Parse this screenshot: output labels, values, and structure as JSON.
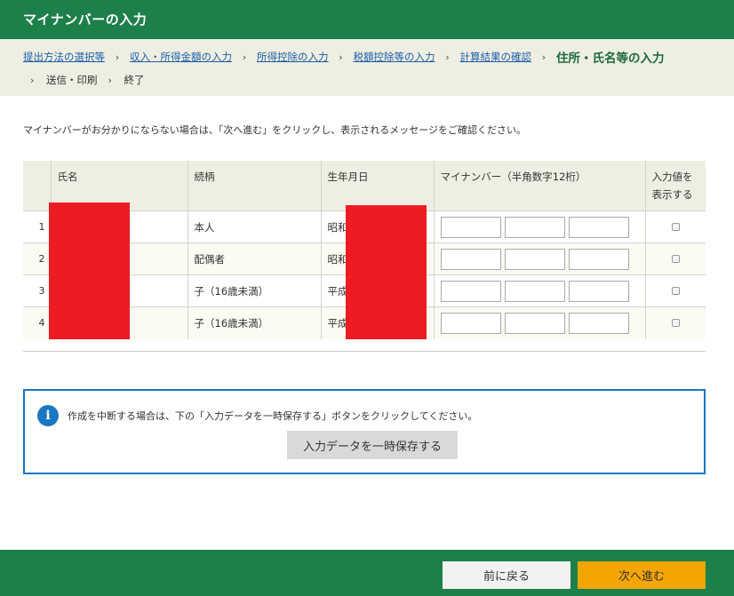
{
  "header": {
    "title": "マイナンバーの入力"
  },
  "breadcrumb": {
    "links": [
      "提出方法の選択等",
      "収入・所得金額の入力",
      "所得控除の入力",
      "税額控除等の入力",
      "計算結果の確認"
    ],
    "current": "住所・氏名等の入力",
    "remaining": [
      "送信・印刷",
      "終了"
    ],
    "separator": "›"
  },
  "instruction": "マイナンバーがお分かりにならない場合は、「次へ進む」をクリックし、表示されるメッセージをご確認ください。",
  "table": {
    "headers": {
      "no": "",
      "name": "氏名",
      "relation": "続柄",
      "birthdate": "生年月日",
      "mynumber": "マイナンバー（半角数字12桁）",
      "show_value_line1": "入力値を",
      "show_value_line2": "表示する"
    },
    "rows": [
      {
        "no": "1",
        "name": "",
        "relation": "本人",
        "birthdate": "昭和",
        "mynumber": [
          "",
          "",
          ""
        ],
        "show": false
      },
      {
        "no": "2",
        "name": "",
        "relation": "配偶者",
        "birthdate": "昭和",
        "mynumber": [
          "",
          "",
          ""
        ],
        "show": false
      },
      {
        "no": "3",
        "name": "",
        "relation": "子（16歳未満）",
        "birthdate": "平成",
        "mynumber": [
          "",
          "",
          ""
        ],
        "show": false
      },
      {
        "no": "4",
        "name": "",
        "relation": "子（16歳未満）",
        "birthdate": "平成",
        "mynumber": [
          "",
          "",
          ""
        ],
        "show": false
      }
    ]
  },
  "notice": {
    "icon": "info-icon",
    "icon_glyph": "i",
    "text": "作成を中断する場合は、下の「入力データを一時保存する」ボタンをクリックしてください。",
    "button": "入力データを一時保存する"
  },
  "footer": {
    "back": "前に戻る",
    "next": "次へ進む"
  },
  "colors": {
    "primary_green": "#1d7f4a",
    "next_button": "#f5a500",
    "info_blue": "#1a78c2",
    "redaction": "#ed1c24"
  }
}
